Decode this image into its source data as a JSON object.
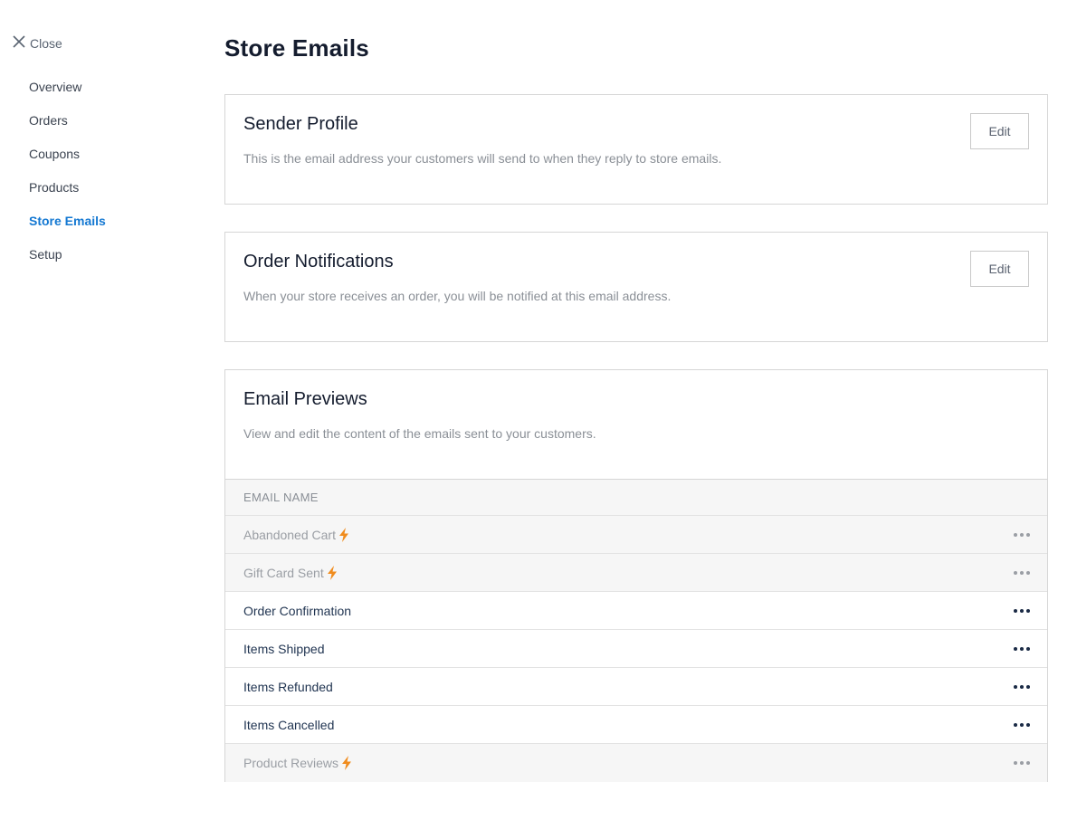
{
  "sidebar": {
    "close_label": "Close",
    "nav_items": [
      {
        "label": "Overview"
      },
      {
        "label": "Orders"
      },
      {
        "label": "Coupons"
      },
      {
        "label": "Products"
      },
      {
        "label": "Store Emails",
        "active": true
      },
      {
        "label": "Setup"
      }
    ]
  },
  "page": {
    "title": "Store Emails"
  },
  "sender_profile": {
    "title": "Sender Profile",
    "description": "This is the email address your customers will send to when they reply to store emails.",
    "edit_label": "Edit"
  },
  "order_notifications": {
    "title": "Order Notifications",
    "description": "When your store receives an order, you will be notified at this email address.",
    "edit_label": "Edit"
  },
  "email_previews": {
    "title": "Email Previews",
    "description": "View and edit the content of the emails sent to your customers.",
    "column_header": "EMAIL NAME",
    "rows": [
      {
        "name": "Abandoned Cart",
        "premium": true
      },
      {
        "name": "Gift Card Sent",
        "premium": true
      },
      {
        "name": "Order Confirmation",
        "premium": false
      },
      {
        "name": "Items Shipped",
        "premium": false
      },
      {
        "name": "Items Refunded",
        "premium": false
      },
      {
        "name": "Items Cancelled",
        "premium": false
      },
      {
        "name": "Product Reviews",
        "premium": true
      }
    ]
  },
  "colors": {
    "accent": "#1478d2",
    "bolt": "#f08c1e",
    "text_dark": "#141c2e",
    "muted": "#8a8f96"
  },
  "icons": {
    "close": "close-icon",
    "premium": "lightning-bolt-icon",
    "more": "more-horizontal-icon"
  }
}
